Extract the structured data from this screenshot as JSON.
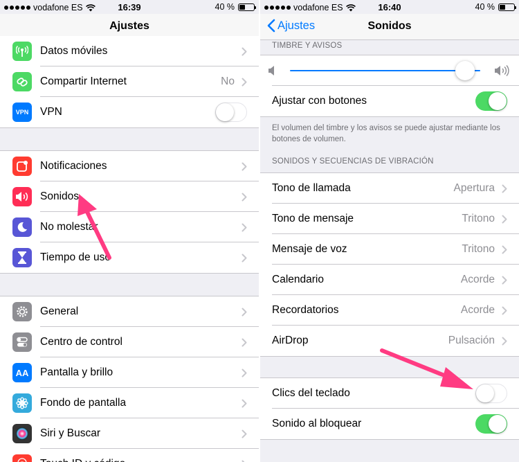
{
  "left": {
    "status": {
      "carrier": "vodafone ES",
      "time": "16:39",
      "battery": "40 %",
      "battery_level": 0.4
    },
    "nav_title": "Ajustes",
    "groups": [
      {
        "items": [
          {
            "label": "Datos móviles",
            "icon": "antenna-icon",
            "color": "#4cd964"
          },
          {
            "label": "Compartir Internet",
            "icon": "chain-link-icon",
            "color": "#4cd964",
            "value": "No"
          },
          {
            "label": "VPN",
            "icon": "vpn-icon",
            "color": "#007aff",
            "icon_text": "VPN",
            "toggle": false
          }
        ]
      },
      {
        "items": [
          {
            "label": "Notificaciones",
            "icon": "notification-icon",
            "color": "#ff3b30"
          },
          {
            "label": "Sonidos",
            "icon": "speaker-icon",
            "color": "#ff2d55"
          },
          {
            "label": "No molestar",
            "icon": "moon-icon",
            "color": "#5856d6"
          },
          {
            "label": "Tiempo de uso",
            "icon": "hourglass-icon",
            "color": "#5856d6"
          }
        ]
      },
      {
        "items": [
          {
            "label": "General",
            "icon": "gear-icon",
            "color": "#8e8e93"
          },
          {
            "label": "Centro de control",
            "icon": "switches-icon",
            "color": "#8e8e93"
          },
          {
            "label": "Pantalla y brillo",
            "icon": "text-size-icon",
            "color": "#007aff",
            "icon_text": "AA"
          },
          {
            "label": "Fondo de pantalla",
            "icon": "flower-icon",
            "color": "#34aadc"
          },
          {
            "label": "Siri y Buscar",
            "icon": "siri-icon",
            "color": "#333333"
          },
          {
            "label": "Touch ID y código",
            "icon": "fingerprint-icon",
            "color": "#ff3b30"
          }
        ]
      }
    ]
  },
  "right": {
    "status": {
      "carrier": "vodafone ES",
      "time": "16:40",
      "battery": "40 %",
      "battery_level": 0.4
    },
    "nav_title": "Sonidos",
    "back_label": "Ajustes",
    "ringer_header": "TIMBRE Y AVISOS",
    "ringer_volume_level": 0.92,
    "adjust_label": "Ajustar con botones",
    "adjust_on": true,
    "ringer_footnote": "El volumen del timbre y los avisos se puede ajustar mediante los botones de volumen.",
    "sounds_header": "SONIDOS Y SECUENCIAS DE VIBRACIÓN",
    "sounds": [
      {
        "label": "Tono de llamada",
        "value": "Apertura"
      },
      {
        "label": "Tono de mensaje",
        "value": "Tritono"
      },
      {
        "label": "Mensaje de voz",
        "value": "Tritono"
      },
      {
        "label": "Calendario",
        "value": "Acorde"
      },
      {
        "label": "Recordatorios",
        "value": "Acorde"
      },
      {
        "label": "AirDrop",
        "value": "Pulsación"
      }
    ],
    "keyboard_clicks_label": "Clics del teclado",
    "keyboard_clicks_on": false,
    "lock_sound_label": "Sonido al bloquear",
    "lock_sound_on": true
  },
  "colors": {
    "accent": "#007aff",
    "switch_on": "#4cd964",
    "annotation_arrow": "#ff3b82"
  }
}
